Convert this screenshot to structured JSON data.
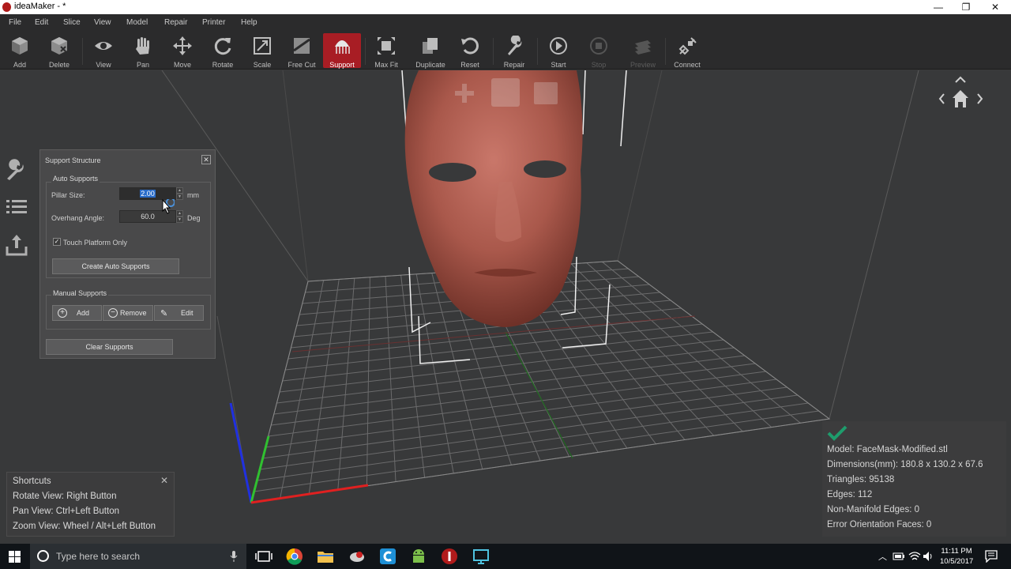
{
  "window": {
    "title": "ideaMaker - *",
    "minimize": "—",
    "maximize": "❐",
    "close": "✕"
  },
  "menu": [
    "File",
    "Edit",
    "Slice",
    "View",
    "Model",
    "Repair",
    "Printer",
    "Help"
  ],
  "toolbar": {
    "items": [
      {
        "label": "Add",
        "icon": "add-cube-icon"
      },
      {
        "label": "Delete",
        "icon": "delete-cube-icon"
      },
      {
        "label": "View",
        "icon": "eye-icon"
      },
      {
        "label": "Pan",
        "icon": "hand-icon"
      },
      {
        "label": "Move",
        "icon": "move-arrows-icon"
      },
      {
        "label": "Rotate",
        "icon": "rotate-icon"
      },
      {
        "label": "Scale",
        "icon": "scale-icon"
      },
      {
        "label": "Free Cut",
        "icon": "free-cut-icon"
      },
      {
        "label": "Support",
        "icon": "support-icon",
        "active": true
      },
      {
        "label": "Max Fit",
        "icon": "max-fit-icon"
      },
      {
        "label": "Duplicate",
        "icon": "duplicate-icon"
      },
      {
        "label": "Reset",
        "icon": "reset-icon"
      },
      {
        "label": "Repair",
        "icon": "wrench-icon"
      },
      {
        "label": "Start",
        "icon": "play-icon"
      },
      {
        "label": "Stop",
        "icon": "stop-icon",
        "disabled": true
      },
      {
        "label": "Preview",
        "icon": "preview-layers-icon",
        "disabled": true
      },
      {
        "label": "Connect",
        "icon": "connect-icon"
      }
    ]
  },
  "support_panel": {
    "title": "Support Structure",
    "close": "✕",
    "auto_supports": {
      "label": "Auto Supports",
      "pillar_size_label": "Pillar Size:",
      "pillar_size_value": "2.00",
      "pillar_size_unit": "mm",
      "overhang_angle_label": "Overhang Angle:",
      "overhang_angle_value": "60.0",
      "overhang_angle_unit": "Deg",
      "touch_platform_label": "Touch Platform Only",
      "touch_platform_checked": true,
      "create_button": "Create Auto Supports"
    },
    "manual_supports": {
      "label": "Manual Supports",
      "add": "Add",
      "remove": "Remove",
      "edit": "Edit"
    },
    "clear_button": "Clear Supports"
  },
  "shortcuts": {
    "title": "Shortcuts",
    "close": "✕",
    "lines": [
      "Rotate View: Right Button",
      "Pan View: Ctrl+Left Button",
      "Zoom View: Wheel / Alt+Left Button"
    ]
  },
  "model_info": {
    "status_icon": "checkmark-icon",
    "status_color": "#1e9c6c",
    "model": "Model: FaceMask-Modified.stl",
    "dimensions": "Dimensions(mm): 180.8 x 130.2 x 67.6",
    "triangles": "Triangles: 95138",
    "edges": "Edges: 112",
    "non_manifold": "Non-Manifold Edges: 0",
    "error_orientation": "Error Orientation Faces: 0"
  },
  "colors": {
    "accent": "#a81d24",
    "model": "#a9584b",
    "axis_x": "#e02020",
    "axis_y": "#30c030",
    "axis_z": "#2030e0"
  },
  "taskbar": {
    "search_placeholder": "Type here to search",
    "time": "11:11 PM",
    "date": "10/5/2017",
    "apps": [
      "task-view-icon",
      "chrome-icon",
      "file-explorer-icon",
      "slicer-app-icon",
      "cortana-c-icon",
      "android-icon",
      "ideamaker-icon",
      "screen-app-icon"
    ]
  }
}
